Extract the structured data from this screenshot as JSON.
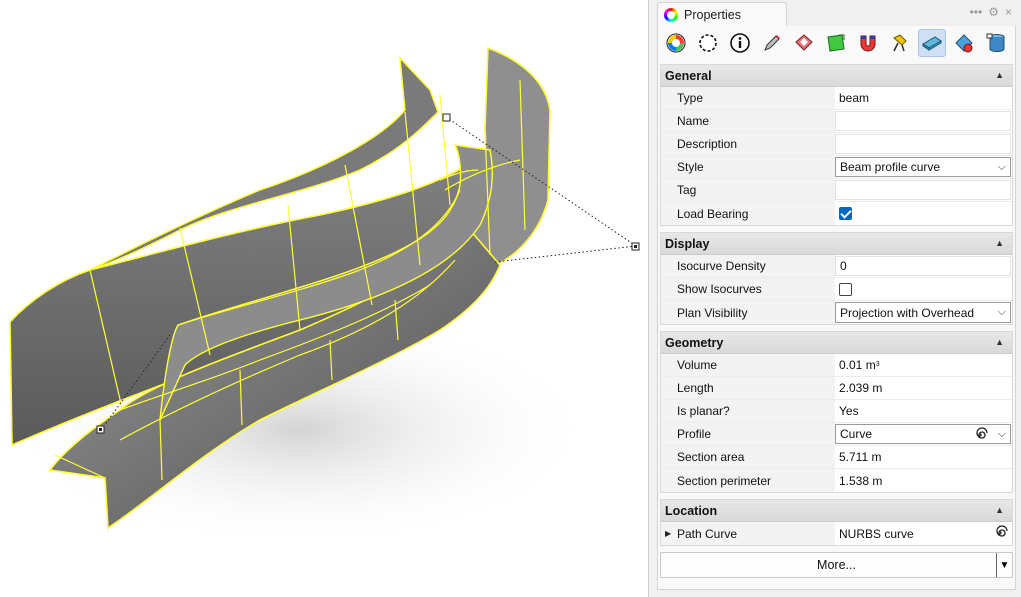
{
  "panel": {
    "tab_title": "Properties",
    "tools": {
      "more": "•••",
      "settings": "⚙",
      "close": "×"
    }
  },
  "toolbar": {
    "buttons": [
      {
        "name": "material-icon"
      },
      {
        "name": "object-icon"
      },
      {
        "name": "info-icon"
      },
      {
        "name": "pencil-icon"
      },
      {
        "name": "decal-icon"
      },
      {
        "name": "texture-mapping-icon"
      },
      {
        "name": "magnet-icon"
      },
      {
        "name": "light-icon"
      },
      {
        "name": "beam-icon",
        "active": true
      },
      {
        "name": "link-icon"
      },
      {
        "name": "database-icon"
      }
    ]
  },
  "sections": {
    "general": {
      "title": "General",
      "type_label": "Type",
      "type_value": "beam",
      "name_label": "Name",
      "name_value": "",
      "description_label": "Description",
      "description_value": "",
      "style_label": "Style",
      "style_value": "Beam profile curve",
      "tag_label": "Tag",
      "tag_value": "",
      "load_bearing_label": "Load Bearing",
      "load_bearing_checked": true
    },
    "display": {
      "title": "Display",
      "isocurve_density_label": "Isocurve Density",
      "isocurve_density_value": "0",
      "show_isocurves_label": "Show Isocurves",
      "show_isocurves_checked": false,
      "plan_visibility_label": "Plan Visibility",
      "plan_visibility_value": "Projection with Overhead"
    },
    "geometry": {
      "title": "Geometry",
      "volume_label": "Volume",
      "volume_value": "0.01 m",
      "volume_exp": "3",
      "length_label": "Length",
      "length_value": "2.039 m",
      "is_planar_label": "Is planar?",
      "is_planar_value": "Yes",
      "profile_label": "Profile",
      "profile_value": "Curve",
      "section_area_label": "Section area",
      "section_area_value": "5.711 m",
      "section_perimeter_label": "Section perimeter",
      "section_perimeter_value": "1.538 m"
    },
    "location": {
      "title": "Location",
      "path_curve_label": "Path Curve",
      "path_curve_value": "NURBS curve"
    }
  },
  "more_button": {
    "label": "More..."
  },
  "colors": {
    "selection": "#ffff33",
    "surface": "#6e6e6e",
    "accent": "#0067c0"
  }
}
